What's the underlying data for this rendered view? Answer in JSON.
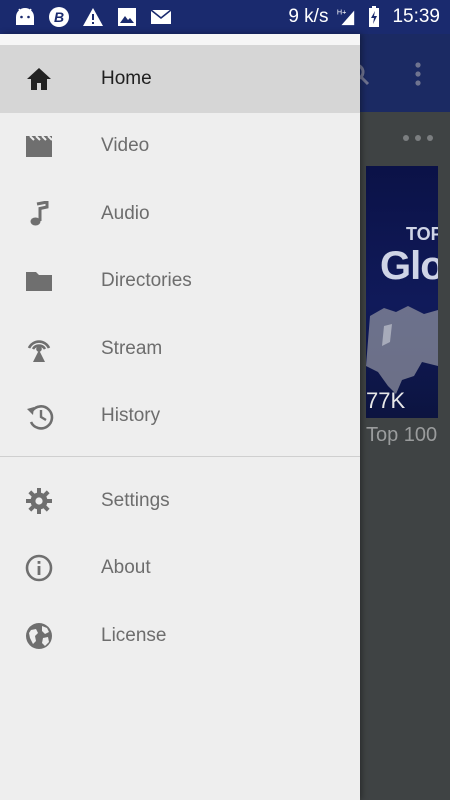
{
  "status_bar": {
    "icons_left": [
      "android-icon",
      "b-badge-icon",
      "warning-icon",
      "image-icon",
      "mail-icon"
    ],
    "speed": "9 k/s",
    "network": "H+",
    "time": "15:39"
  },
  "drawer": {
    "primary_items": [
      {
        "label": "Home",
        "icon": "home-icon",
        "selected": true
      },
      {
        "label": "Video",
        "icon": "video-clapper-icon",
        "selected": false
      },
      {
        "label": "Audio",
        "icon": "music-note-icon",
        "selected": false
      },
      {
        "label": "Directories",
        "icon": "folder-icon",
        "selected": false
      },
      {
        "label": "Stream",
        "icon": "stream-antenna-icon",
        "selected": false
      },
      {
        "label": "History",
        "icon": "history-icon",
        "selected": false
      }
    ],
    "secondary_items": [
      {
        "label": "Settings",
        "icon": "gear-icon"
      },
      {
        "label": "About",
        "icon": "info-icon"
      },
      {
        "label": "License",
        "icon": "globe-icon"
      }
    ]
  },
  "background_content": {
    "thumbnail_top_text": "TOP",
    "thumbnail_big_text": "Glo",
    "thumbnail_views": "77K",
    "thumbnail_title": "Top 100"
  },
  "colors": {
    "status_bar": "#1a2a6e",
    "toolbar": "#1b2a63",
    "drawer_bg": "#eeeeee",
    "selected_bg": "#d6d6d6"
  }
}
